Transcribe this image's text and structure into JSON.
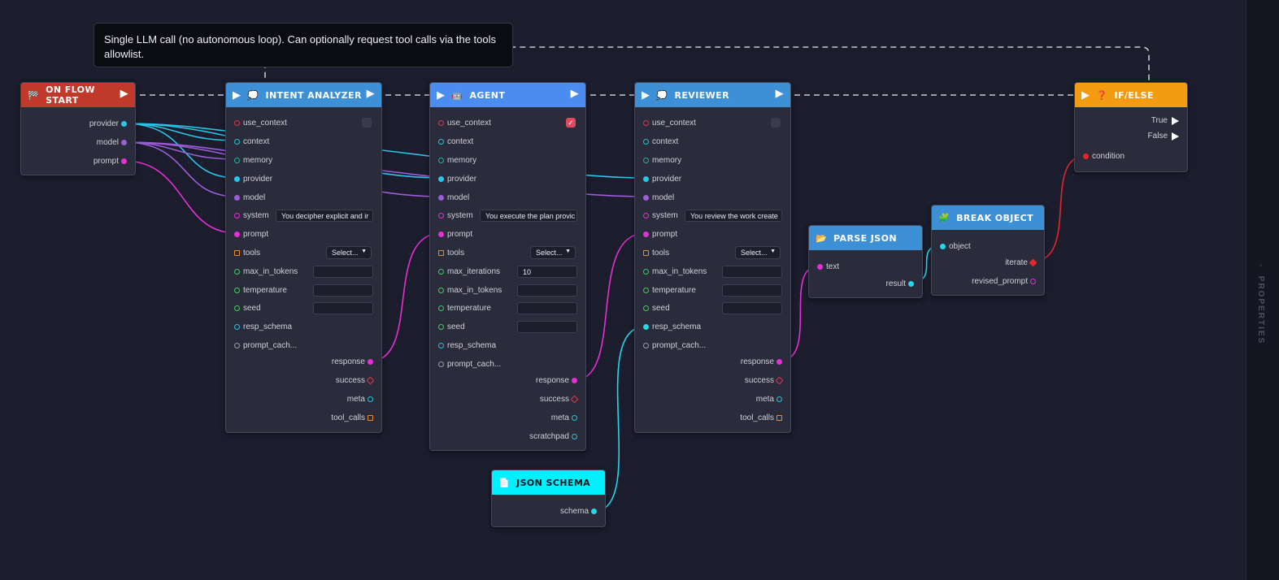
{
  "tooltip": {
    "text": "Single LLM call (no autonomous loop). Can optionally request tool calls via the tools allowlist."
  },
  "sidebar": {
    "tab_label": "◦ PROPERTIES"
  },
  "colors": {
    "provider": "#29c6e8",
    "model": "#9c5dd8",
    "prompt": "#e62fd6",
    "context": "#27c4d6",
    "memory": "#1fb39c",
    "tools": "#f08a2b",
    "green": "#3ecf5c",
    "red": "#e2364b",
    "exec_edge": "#c8c9d2",
    "json_edge": "#22d8ea",
    "condition": "#e3262e"
  },
  "nodes": {
    "on_flow_start": {
      "title": "ON FLOW START",
      "icon": "checkered-flag-icon",
      "header_color": "#c0392b",
      "outputs": [
        "provider",
        "model",
        "prompt"
      ]
    },
    "intent_analyzer": {
      "title": "INTENT ANALYZER",
      "icon": "brain-icon",
      "header_color": "#3d8fd6",
      "inputs": {
        "use_context": "use_context",
        "context": "context",
        "memory": "memory",
        "provider": "provider",
        "model": "model",
        "system": "system",
        "system_value": "You decipher explicit and ir",
        "prompt": "prompt",
        "tools": "tools",
        "tools_value": "Select...",
        "max_in_tokens": "max_in_tokens",
        "temperature": "temperature",
        "seed": "seed",
        "resp_schema": "resp_schema",
        "prompt_cach": "prompt_cach..."
      },
      "outputs": [
        "response",
        "success",
        "meta",
        "tool_calls"
      ]
    },
    "agent": {
      "title": "AGENT",
      "icon": "robot-icon",
      "header_color": "#4a8cf0",
      "inputs": {
        "use_context": "use_context",
        "context": "context",
        "memory": "memory",
        "provider": "provider",
        "model": "model",
        "system": "system",
        "system_value": "You execute the plan provic",
        "prompt": "prompt",
        "tools": "tools",
        "tools_value": "Select...",
        "max_iterations": "max_iterations",
        "max_iterations_value": "10",
        "max_in_tokens": "max_in_tokens",
        "temperature": "temperature",
        "seed": "seed",
        "resp_schema": "resp_schema",
        "prompt_cach": "prompt_cach..."
      },
      "outputs": [
        "response",
        "success",
        "meta",
        "scratchpad"
      ]
    },
    "reviewer": {
      "title": "REVIEWER",
      "icon": "brain-icon",
      "header_color": "#3d8fd6",
      "inputs": {
        "use_context": "use_context",
        "context": "context",
        "memory": "memory",
        "provider": "provider",
        "model": "model",
        "system": "system",
        "system_value": "You review the work create",
        "prompt": "prompt",
        "tools": "tools",
        "tools_value": "Select...",
        "max_in_tokens": "max_in_tokens",
        "temperature": "temperature",
        "seed": "seed",
        "resp_schema": "resp_schema",
        "prompt_cach": "prompt_cach..."
      },
      "outputs": [
        "response",
        "success",
        "meta",
        "tool_calls"
      ]
    },
    "json_schema": {
      "title": "JSON SCHEMA",
      "icon": "document-icon",
      "header_color": "#00f0ff",
      "outputs": [
        "schema"
      ]
    },
    "parse_json": {
      "title": "PARSE JSON",
      "icon": "folder-icon",
      "header_color": "#3d8fd6",
      "inputs": [
        "text"
      ],
      "outputs": [
        "result"
      ]
    },
    "break_object": {
      "title": "BREAK OBJECT",
      "icon": "puzzle-icon",
      "header_color": "#3d8fd6",
      "inputs": [
        "object"
      ],
      "outputs": [
        "iterate",
        "revised_prompt"
      ]
    },
    "if_else": {
      "title": "IF/ELSE",
      "icon": "question-icon",
      "header_color": "#f39c12",
      "outputs": [
        "True",
        "False"
      ],
      "inputs": [
        "condition"
      ]
    }
  }
}
